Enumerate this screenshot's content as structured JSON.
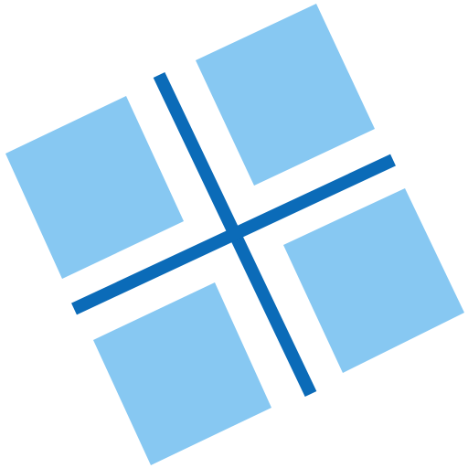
{
  "icon": {
    "name": "rotated-window-grid-icon",
    "colors": {
      "background": "#ffffff",
      "pane": "#87c8f2",
      "cross": "#0b6bb8"
    }
  }
}
